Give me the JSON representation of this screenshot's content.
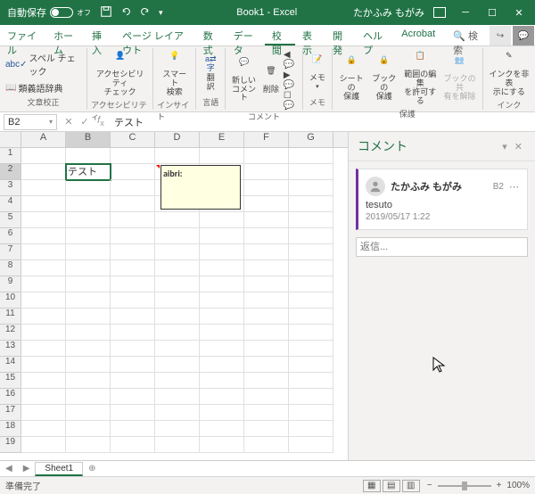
{
  "titlebar": {
    "autosave_label": "自動保存",
    "autosave_state": "オフ",
    "title": "Book1 - Excel",
    "user": "たかふみ もがみ"
  },
  "tabs": {
    "file": "ファイル",
    "home": "ホーム",
    "insert": "挿入",
    "layout": "ページ レイアウト",
    "formulas": "数式",
    "data": "データ",
    "review": "校閲",
    "view": "表示",
    "developer": "開発",
    "help": "ヘルプ",
    "acrobat": "Acrobat",
    "search": "検索"
  },
  "ribbon": {
    "group1": {
      "spellcheck": "スペル チェック",
      "thesaurus": "類義語辞典",
      "label": "文章校正"
    },
    "group2": {
      "access": "アクセシビリティ\nチェック",
      "label": "アクセシビリティ"
    },
    "group3": {
      "smart": "スマート\n検索",
      "label": "インサイト"
    },
    "group4": {
      "translate": "翻\n訳",
      "label": "言語"
    },
    "group5": {
      "new": "新しい\nコメント",
      "delete": "削除",
      "label": "コメント"
    },
    "group6": {
      "memo": "メモ",
      "label": "メモ"
    },
    "group7": {
      "sheet": "シートの\n保護",
      "book": "ブックの\n保護",
      "range": "範囲の編集\nを許可する",
      "share": "ブックの共\n有を解除",
      "label": "保護"
    },
    "group8": {
      "ink": "インクを非表\n示にする",
      "label": "インク"
    }
  },
  "formula_bar": {
    "namebox": "B2",
    "formula": "テスト"
  },
  "columns": [
    "A",
    "B",
    "C",
    "D",
    "E",
    "F",
    "G"
  ],
  "cells": {
    "B2": "テスト"
  },
  "note": {
    "text": "aibri:"
  },
  "comments_pane": {
    "title": "コメント",
    "comment": {
      "author": "たかふみ もがみ",
      "cell": "B2",
      "text": "tesuto",
      "time": "2019/05/17 1:22"
    },
    "reply_placeholder": "返信..."
  },
  "sheet_tabs": {
    "sheet1": "Sheet1"
  },
  "statusbar": {
    "status": "準備完了",
    "zoom": "100%"
  }
}
